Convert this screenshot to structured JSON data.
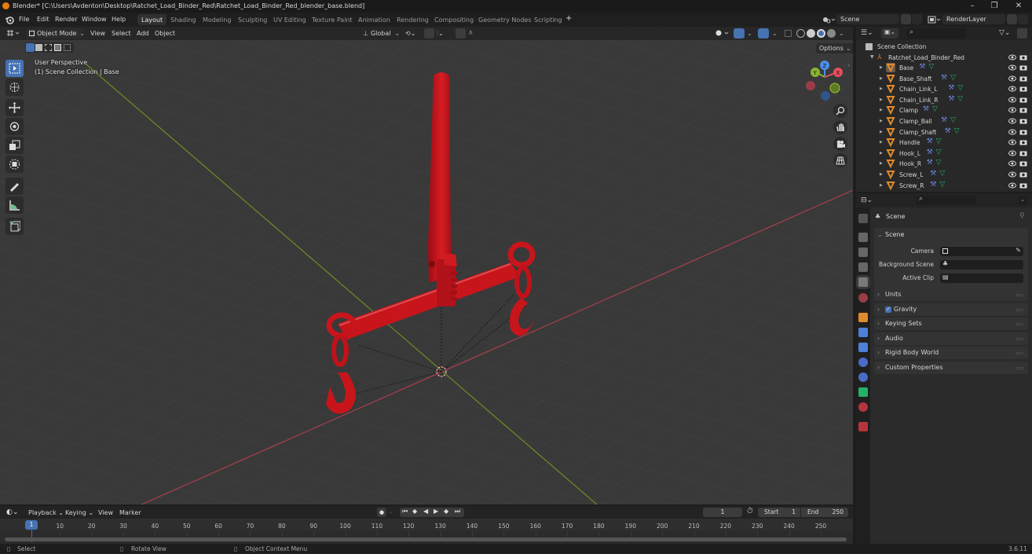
{
  "window": {
    "title": "Blender* [C:\\Users\\Avdenton\\Desktop\\Ratchet_Load_Binder_Red\\Ratchet_Load_Binder_Red_blender_base.blend]",
    "controls": {
      "minimize": "–",
      "maximize": "❐",
      "close": "✕"
    }
  },
  "menubar": {
    "menus": [
      "File",
      "Edit",
      "Render",
      "Window",
      "Help"
    ],
    "workspaces": [
      "Layout",
      "Shading",
      "Modeling",
      "Sculpting",
      "UV Editing",
      "Texture Paint",
      "Animation",
      "Rendering",
      "Compositing",
      "Geometry Nodes",
      "Scripting"
    ],
    "active_workspace": "Layout",
    "add_workspace": "+",
    "scene_name": "Scene",
    "view_layer": "RenderLayer"
  },
  "viewport": {
    "mode": "Object Mode",
    "menus": [
      "View",
      "Select",
      "Add",
      "Object"
    ],
    "transform_orientation": "Global",
    "options_label": "Options",
    "overlay_line1": "User Perspective",
    "overlay_line2": "(1) Scene Collection | Base",
    "gizmo": {
      "x": "X",
      "y": "Y",
      "z": "Z"
    },
    "tools": [
      "select-box",
      "cursor",
      "move",
      "rotate",
      "scale",
      "transform",
      "annotate",
      "measure",
      "add-cube"
    ],
    "active_tool": "select-box",
    "colors": {
      "x_axis": "#a8404b",
      "y_axis": "#6b8f22",
      "object": "#c8151c",
      "active_tool": "#4772b3"
    }
  },
  "outliner": {
    "root": "Scene Collection",
    "collection": "Ratchet_Load_Binder_Red",
    "objects": [
      "Base",
      "Base_Shaft",
      "Chain_Link_L",
      "Chain_Link_R",
      "Clamp",
      "Clamp_Ball",
      "Clamp_Shaft",
      "Handle",
      "Hook_L",
      "Hook_R",
      "Screw_L",
      "Screw_R"
    ],
    "active_object": "Base"
  },
  "properties": {
    "context": "Scene",
    "section": "Scene",
    "fields": [
      {
        "label": "Camera",
        "value": ""
      },
      {
        "label": "Background Scene",
        "value": ""
      },
      {
        "label": "Active Clip",
        "value": ""
      }
    ],
    "panels": [
      {
        "label": "Units",
        "checkbox": false
      },
      {
        "label": "Gravity",
        "checkbox": true,
        "checked": true
      },
      {
        "label": "Keying Sets",
        "checkbox": false
      },
      {
        "label": "Audio",
        "checkbox": false
      },
      {
        "label": "Rigid Body World",
        "checkbox": false
      },
      {
        "label": "Custom Properties",
        "checkbox": false
      }
    ]
  },
  "timeline": {
    "menus": [
      "Playback",
      "Keying",
      "View",
      "Marker"
    ],
    "current_frame": "1",
    "start_label": "Start",
    "start": "1",
    "end_label": "End",
    "end": "250",
    "ticks": [
      "10",
      "20",
      "30",
      "40",
      "50",
      "60",
      "70",
      "80",
      "90",
      "100",
      "110",
      "120",
      "130",
      "140",
      "150",
      "160",
      "170",
      "180",
      "190",
      "200",
      "210",
      "220",
      "230",
      "240",
      "250"
    ],
    "playhead": "1"
  },
  "statusbar": {
    "items": [
      "Select",
      "Rotate View",
      "Object Context Menu"
    ],
    "version": "3.6.11"
  }
}
